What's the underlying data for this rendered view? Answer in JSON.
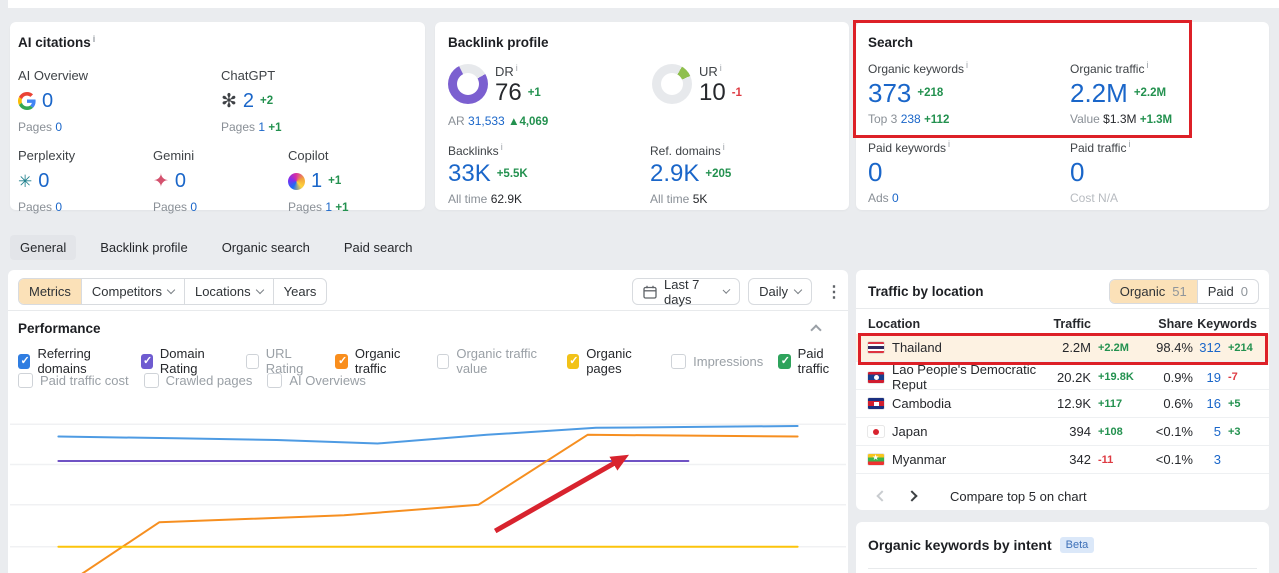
{
  "colors": {
    "accent_blue": "#1a66c9",
    "positive_green": "#23914f",
    "negative_red": "#de3a42",
    "muted_gray": "#898f96",
    "dark_text": "#26282c",
    "annotation_red": "#dd2027",
    "selected_orange_bg": "#fbe1b8",
    "highlight_row_bg": "#fdf2e2",
    "dr_donut_purple": "#7b5fd0",
    "ur_donut_green": "#8fbf4d",
    "checkbox_blue": "#2f7de1",
    "checkbox_purple": "#6e5bd0",
    "checkbox_orange": "#f98e1d",
    "checkbox_yellow": "#f2c218",
    "checkbox_green": "#2ea35c",
    "beta_badge_bg": "#dbe8f9",
    "beta_badge_text": "#3d70b8"
  },
  "ai_citations": {
    "title": "AI citations",
    "pages_label": "Pages",
    "items": [
      {
        "label": "AI Overview",
        "value": "0",
        "delta": "",
        "pages": "0",
        "pages_delta": ""
      },
      {
        "label": "ChatGPT",
        "value": "2",
        "delta": "+2",
        "pages": "1",
        "pages_delta": "+1"
      },
      {
        "label": "Perplexity",
        "value": "0",
        "delta": "",
        "pages": "0",
        "pages_delta": ""
      },
      {
        "label": "Gemini",
        "value": "0",
        "delta": "",
        "pages": "0",
        "pages_delta": ""
      },
      {
        "label": "Copilot",
        "value": "1",
        "delta": "+1",
        "pages": "1",
        "pages_delta": "+1"
      }
    ]
  },
  "backlink_profile": {
    "title": "Backlink profile",
    "dr": {
      "label": "DR",
      "value": "76",
      "delta": "+1",
      "pct": 76
    },
    "ur": {
      "label": "UR",
      "value": "10",
      "delta": "-1",
      "pct": 10
    },
    "ar": {
      "label": "AR",
      "value": "31,533",
      "delta": "▲4,069"
    },
    "backlinks": {
      "label": "Backlinks",
      "value": "33K",
      "delta": "+5.5K",
      "alltime_label": "All time",
      "alltime_value": "62.9K"
    },
    "ref_domains": {
      "label": "Ref. domains",
      "value": "2.9K",
      "delta": "+205",
      "alltime_label": "All time",
      "alltime_value": "5K"
    }
  },
  "search": {
    "title": "Search",
    "organic_keywords": {
      "label": "Organic keywords",
      "value": "373",
      "delta": "+218",
      "sub_label": "Top 3",
      "sub_value": "238",
      "sub_delta": "+112"
    },
    "organic_traffic": {
      "label": "Organic traffic",
      "value": "2.2M",
      "delta": "+2.2M",
      "sub_label": "Value",
      "sub_value": "$1.3M",
      "sub_delta": "+1.3M"
    },
    "paid_keywords": {
      "label": "Paid keywords",
      "value": "0",
      "delta": "",
      "sub_label": "Ads",
      "sub_value": "0",
      "sub_delta": ""
    },
    "paid_traffic": {
      "label": "Paid traffic",
      "value": "0",
      "delta": "",
      "sub_label": "Cost",
      "sub_value": "N/A",
      "sub_delta": ""
    }
  },
  "tabs": {
    "items": [
      {
        "label": "General"
      },
      {
        "label": "Backlink profile"
      },
      {
        "label": "Organic search"
      },
      {
        "label": "Paid search"
      }
    ]
  },
  "toolbar": {
    "metrics_label": "Metrics",
    "competitors_label": "Competitors",
    "locations_label": "Locations",
    "years_label": "Years",
    "date_range_label": "Last 7 days",
    "granularity_label": "Daily"
  },
  "performance": {
    "title": "Performance",
    "row1": [
      {
        "label": "Referring domains",
        "checked": true
      },
      {
        "label": "Domain Rating",
        "checked": true
      },
      {
        "label": "URL Rating",
        "checked": false
      },
      {
        "label": "Organic traffic",
        "checked": true
      },
      {
        "label": "Organic traffic value",
        "checked": false
      },
      {
        "label": "Organic pages",
        "checked": true
      },
      {
        "label": "Impressions",
        "checked": false
      },
      {
        "label": "Paid traffic",
        "checked": true
      }
    ],
    "row2": [
      {
        "label": "Paid traffic cost",
        "checked": false
      },
      {
        "label": "Crawled pages",
        "checked": false
      },
      {
        "label": "AI Overviews",
        "checked": false
      }
    ]
  },
  "chart_data": {
    "type": "line",
    "title": "Performance",
    "x_axis": "time (Last 7 days, Daily)",
    "axis_labels_visible": false,
    "grid": true,
    "gridlines_y_pct": [
      15,
      38,
      61,
      85
    ],
    "series": [
      {
        "name": "Referring domains",
        "color": "#4e9be3",
        "points_pct": [
          [
            6,
            22
          ],
          [
            20,
            23
          ],
          [
            32,
            24
          ],
          [
            44,
            26
          ],
          [
            57,
            21
          ],
          [
            70,
            17
          ],
          [
            82,
            16.5
          ],
          [
            94,
            16
          ]
        ]
      },
      {
        "name": "Domain Rating",
        "color": "#6f52c4",
        "points_pct": [
          [
            6,
            36
          ],
          [
            81,
            36
          ]
        ]
      },
      {
        "name": "Organic traffic",
        "color": "#f68f20",
        "points_pct": [
          [
            8,
            103
          ],
          [
            18,
            71
          ],
          [
            40,
            67
          ],
          [
            56,
            61
          ],
          [
            69,
            21
          ],
          [
            94,
            22
          ]
        ]
      },
      {
        "name": "Organic pages",
        "color": "#fcc40b",
        "points_pct": [
          [
            6,
            85
          ],
          [
            94,
            85
          ]
        ]
      }
    ],
    "annotation_arrow": {
      "from_pct": [
        58,
        76
      ],
      "to_pct": [
        73,
        35
      ],
      "color": "#d8232e"
    }
  },
  "traffic_by_location": {
    "title": "Traffic by location",
    "toggle": {
      "organic_label": "Organic",
      "organic_count": "51",
      "paid_label": "Paid",
      "paid_count": "0"
    },
    "columns": [
      "Location",
      "Traffic",
      "Share",
      "Keywords"
    ],
    "rows": [
      {
        "location": "Thailand",
        "traffic": "2.2M",
        "traffic_delta": "+2.2M",
        "share": "98.4%",
        "keywords": "312",
        "keywords_delta": "+214"
      },
      {
        "location": "Lao People's Democratic Reput",
        "traffic": "20.2K",
        "traffic_delta": "+19.8K",
        "share": "0.9%",
        "keywords": "19",
        "keywords_delta": "-7"
      },
      {
        "location": "Cambodia",
        "traffic": "12.9K",
        "traffic_delta": "+117",
        "share": "0.6%",
        "keywords": "16",
        "keywords_delta": "+5"
      },
      {
        "location": "Japan",
        "traffic": "394",
        "traffic_delta": "+108",
        "share": "<0.1%",
        "keywords": "5",
        "keywords_delta": "+3"
      },
      {
        "location": "Myanmar",
        "traffic": "342",
        "traffic_delta": "-11",
        "share": "<0.1%",
        "keywords": "3",
        "keywords_delta": ""
      }
    ],
    "compare_label": "Compare top 5 on chart"
  },
  "intent": {
    "title": "Organic keywords by intent",
    "badge": "Beta"
  }
}
